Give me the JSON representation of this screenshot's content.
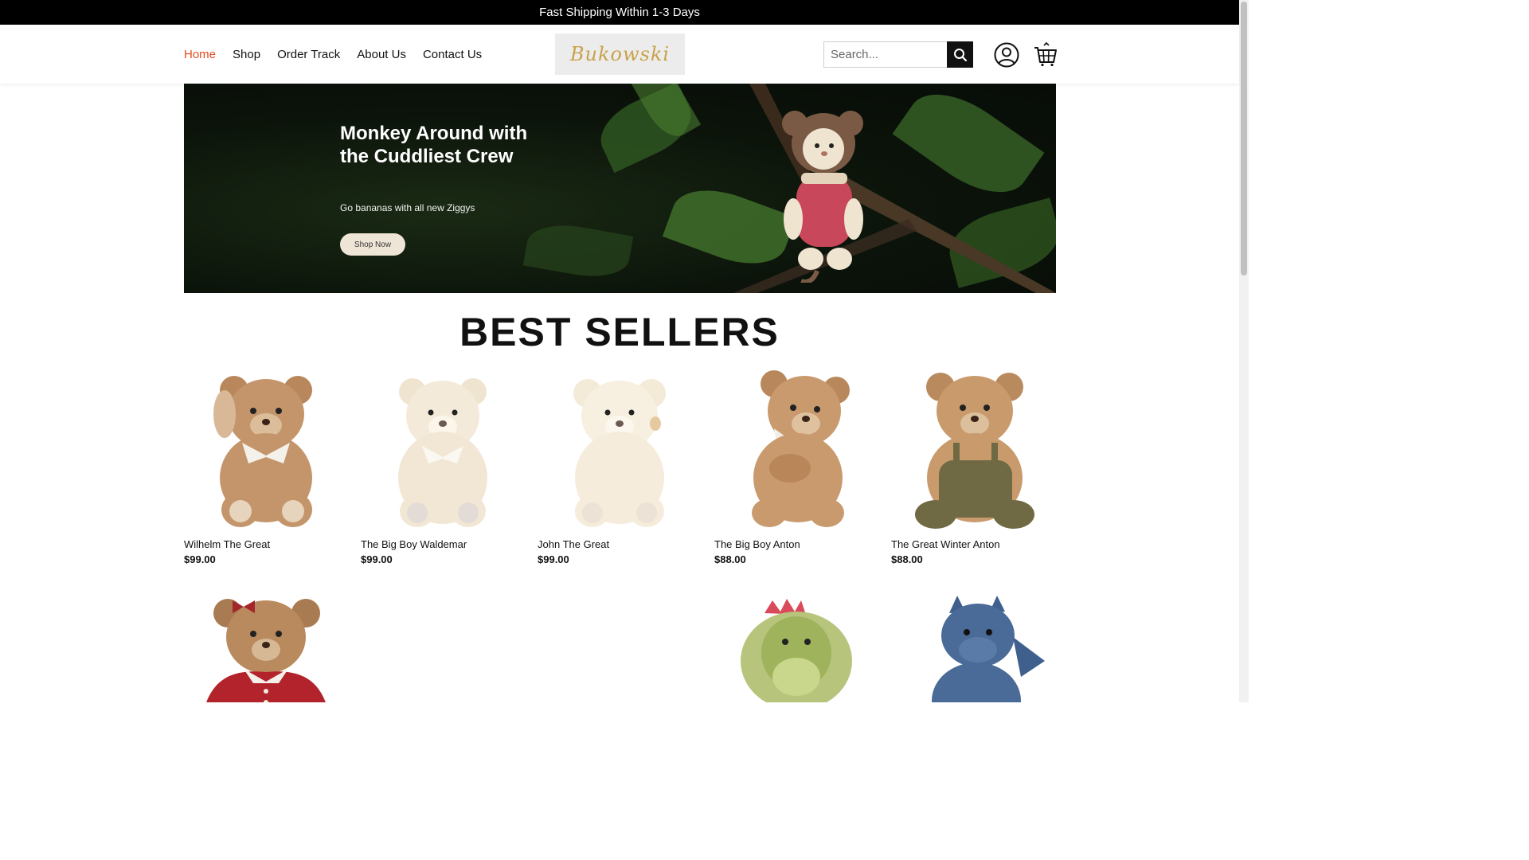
{
  "topbar": {
    "text": "Fast Shipping Within 1-3 Days"
  },
  "nav": {
    "items": [
      {
        "label": "Home"
      },
      {
        "label": "Shop"
      },
      {
        "label": "Order Track"
      },
      {
        "label": "About Us"
      },
      {
        "label": "Contact Us"
      }
    ]
  },
  "logo": {
    "text": "Bukowski"
  },
  "search": {
    "placeholder": "Search..."
  },
  "icons": {
    "search": "search-icon",
    "account": "user-icon",
    "cart": "cart-icon"
  },
  "hero": {
    "title": "Monkey Around with the Cuddliest Crew",
    "subtitle": "Go bananas with all new Ziggys",
    "button": "Shop Now"
  },
  "section": {
    "title": "BEST SELLERS"
  },
  "products": [
    {
      "name": "Wilhelm The Great",
      "price": "$99.00"
    },
    {
      "name": "The Big Boy Waldemar",
      "price": "$99.00"
    },
    {
      "name": "John The Great",
      "price": "$99.00"
    },
    {
      "name": "The Big Boy Anton",
      "price": "$88.00"
    },
    {
      "name": "The Great Winter Anton",
      "price": "$88.00"
    }
  ],
  "colors": {
    "accent": "#e24a1c",
    "topbar": "#000000",
    "logo_gold": "#c9a24a"
  }
}
